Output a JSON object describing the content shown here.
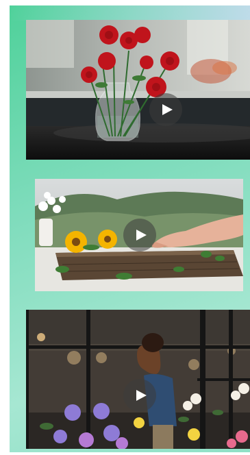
{
  "videos": [
    {
      "name": "red-flowers-vase-video",
      "play_icon": "play-icon"
    },
    {
      "name": "sunflowers-on-wooden-table-video",
      "play_icon": "play-icon"
    },
    {
      "name": "boy-at-flower-shop-window-video",
      "play_icon": "play-icon"
    }
  ],
  "colors": {
    "panel_start": "#4fd19a",
    "panel_end": "#a6e7d2",
    "play_bg": "rgba(60,60,60,0.55)"
  }
}
